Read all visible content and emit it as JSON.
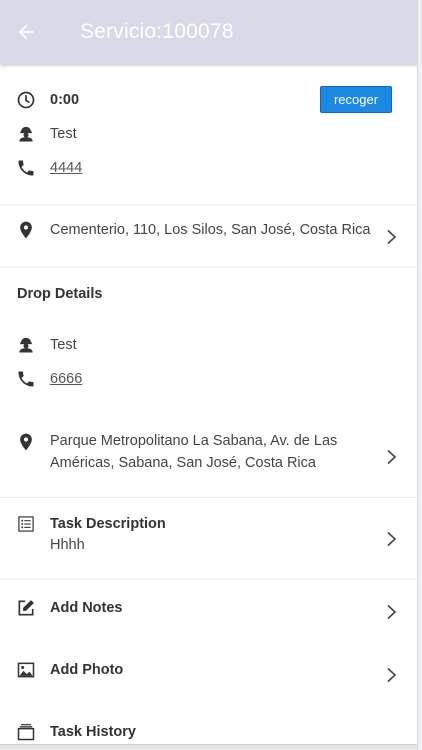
{
  "header": {
    "title": "Servicio:100078"
  },
  "pickup": {
    "time": "0:00",
    "action_label": "recoger",
    "name": "Test",
    "phone": "4444",
    "address": "Cementerio, 110, Los Silos, San José, Costa Rica"
  },
  "drop": {
    "section_title": "Drop Details",
    "name": "Test",
    "phone": "6666",
    "address_line1": "Parque Metropolitano La Sabana, Av. de Las",
    "address_line2": "Américas, Sabana, San José, Costa Rica"
  },
  "task": {
    "label": "Task Description",
    "value": "Hhhh"
  },
  "actions": {
    "add_notes": "Add Notes",
    "add_photo": "Add Photo",
    "task_history": "Task History"
  },
  "colors": {
    "appbar": "#d9d9e8",
    "accent": "#1e88e5"
  }
}
